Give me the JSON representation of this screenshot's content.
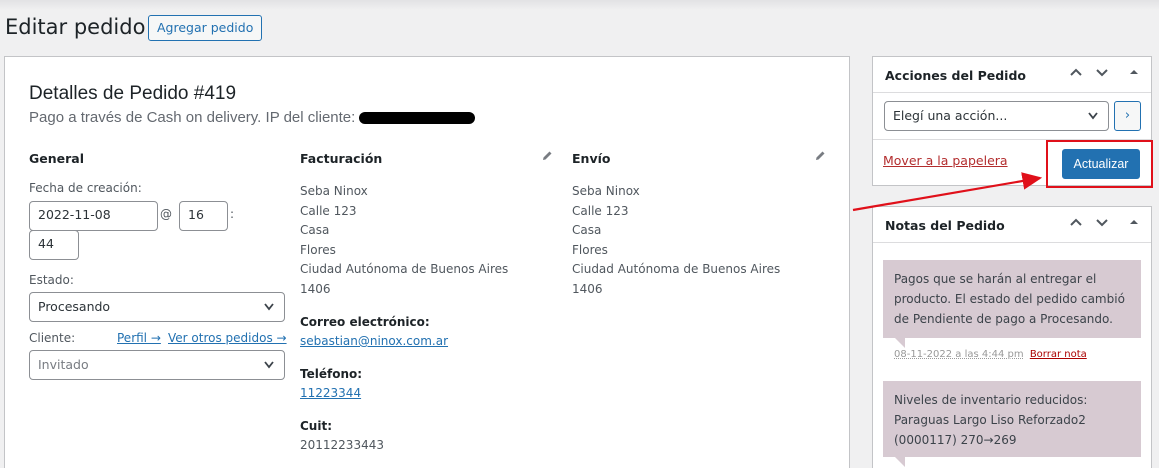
{
  "page": {
    "title": "Editar pedido",
    "add_button": "Agregar pedido"
  },
  "order": {
    "heading": "Detalles de Pedido #419",
    "subheading": "Pago a través de Cash on delivery. IP del cliente:"
  },
  "general": {
    "title": "General",
    "date_label": "Fecha de creación:",
    "date_value": "2022-11-08",
    "at_sign": "@",
    "hour_value": "16",
    "colon": ":",
    "minute_value": "44",
    "status_label": "Estado:",
    "status_value": "Procesando",
    "customer_label": "Cliente:",
    "profile_link": "Perfil →",
    "other_orders_link": "Ver otros pedidos →",
    "customer_value": "Invitado"
  },
  "billing": {
    "title": "Facturación",
    "address": [
      "Seba Ninox",
      "Calle 123",
      "Casa",
      "Flores",
      "Ciudad Autónoma de Buenos Aires",
      "1406"
    ],
    "email_label": "Correo electrónico:",
    "email": "sebastian@ninox.com.ar",
    "phone_label": "Teléfono:",
    "phone": "11223344",
    "cuit_label": "Cuit:",
    "cuit": "20112233443"
  },
  "shipping": {
    "title": "Envío",
    "address": [
      "Seba Ninox",
      "Calle 123",
      "Casa",
      "Flores",
      "Ciudad Autónoma de Buenos Aires",
      "1406"
    ]
  },
  "actions": {
    "title": "Acciones del Pedido",
    "select_placeholder": "Elegí una acción...",
    "go_label": "›",
    "trash_link": "Mover a la papelera",
    "update_button": "Actualizar"
  },
  "notes": {
    "title": "Notas del Pedido",
    "items": [
      {
        "text": "Pagos que se harán al entregar el producto. El estado del pedido cambió de Pendiente de pago a Procesando.",
        "meta": "08-11-2022 a las 4:44 pm",
        "delete": "Borrar nota"
      },
      {
        "text": "Niveles de inventario reducidos: Paraguas Largo Liso Reforzado2 (0000117) 270→269"
      }
    ]
  },
  "colors": {
    "accent": "#2271b1",
    "note_bg": "#d7cad2",
    "highlight": "#e0101a"
  }
}
